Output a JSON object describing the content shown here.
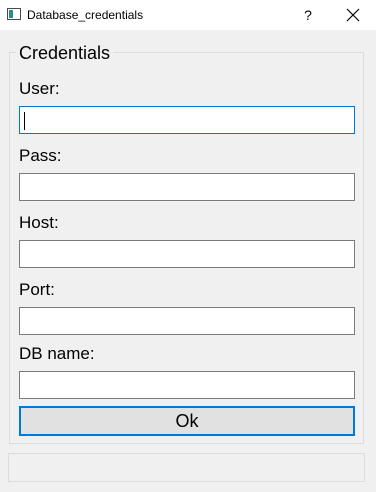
{
  "window": {
    "title": "Database_credentials",
    "help_glyph": "?",
    "close_icon": "close-icon"
  },
  "group": {
    "title": "Credentials"
  },
  "fields": [
    {
      "label": "User:",
      "value": "",
      "focused": true
    },
    {
      "label": "Pass:",
      "value": ""
    },
    {
      "label": "Host:",
      "value": ""
    },
    {
      "label": "Port:",
      "value": ""
    },
    {
      "label": "DB name:",
      "value": ""
    }
  ],
  "ok_button": {
    "label": "Ok"
  },
  "status": {
    "text": ""
  },
  "colors": {
    "focus_border": "#0078d7",
    "window_bg": "#f0f0f0",
    "titlebar_bg": "#ffffff"
  }
}
